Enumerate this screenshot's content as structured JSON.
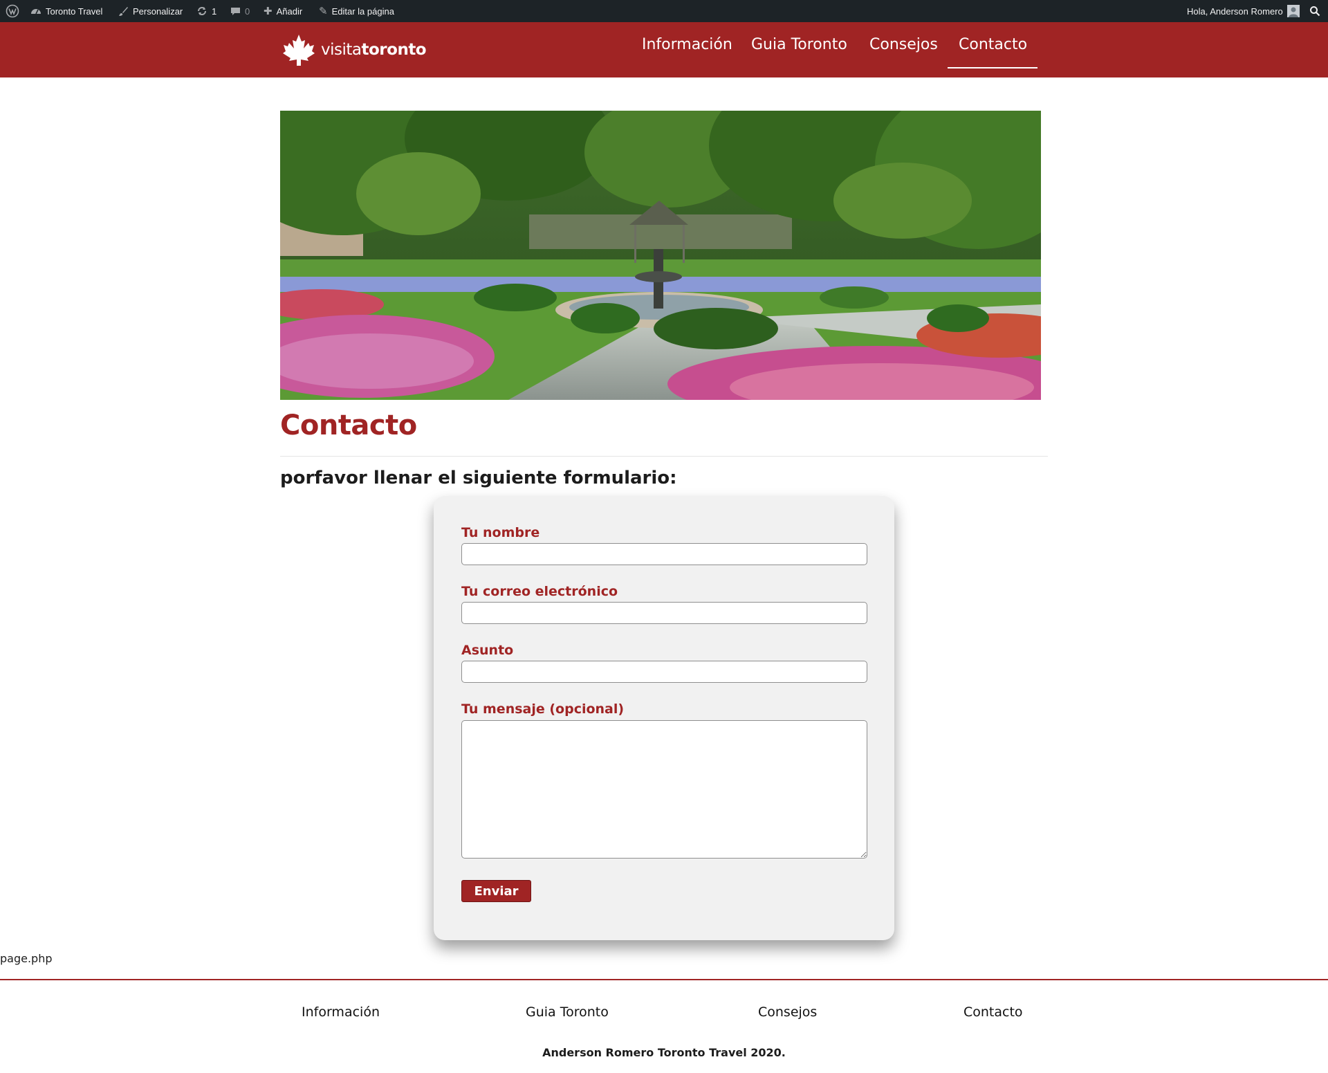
{
  "colors": {
    "brand": "#a02424",
    "admin_bar": "#1d2327",
    "card": "#f1f1f1"
  },
  "admin_bar": {
    "wp_icon": "wordpress-icon",
    "site_name": "Toronto Travel",
    "customize": "Personalizar",
    "updates_count": "1",
    "comments_count": "0",
    "add_new": "Añadir",
    "edit_page": "Editar la página",
    "greeting": "Hola, Anderson Romero"
  },
  "header": {
    "logo_light": "visita",
    "logo_bold": "toronto",
    "nav": [
      "Información",
      "Guia Toronto",
      "Consejos",
      "Contacto"
    ],
    "active": "Contacto"
  },
  "page": {
    "title": "Contacto",
    "intro": "porfavor llenar el siguiente formulario:"
  },
  "form": {
    "name_label": "Tu nombre",
    "name_value": "",
    "email_label": "Tu correo electrónico",
    "email_value": "",
    "subject_label": "Asunto",
    "subject_value": "",
    "message_label": "Tu mensaje (opcional)",
    "message_value": "",
    "submit_label": "Enviar"
  },
  "debug_text": "page.php",
  "footer": {
    "nav": [
      "Información",
      "Guia Toronto",
      "Consejos",
      "Contacto"
    ],
    "copyright": "Anderson Romero Toronto Travel 2020."
  }
}
